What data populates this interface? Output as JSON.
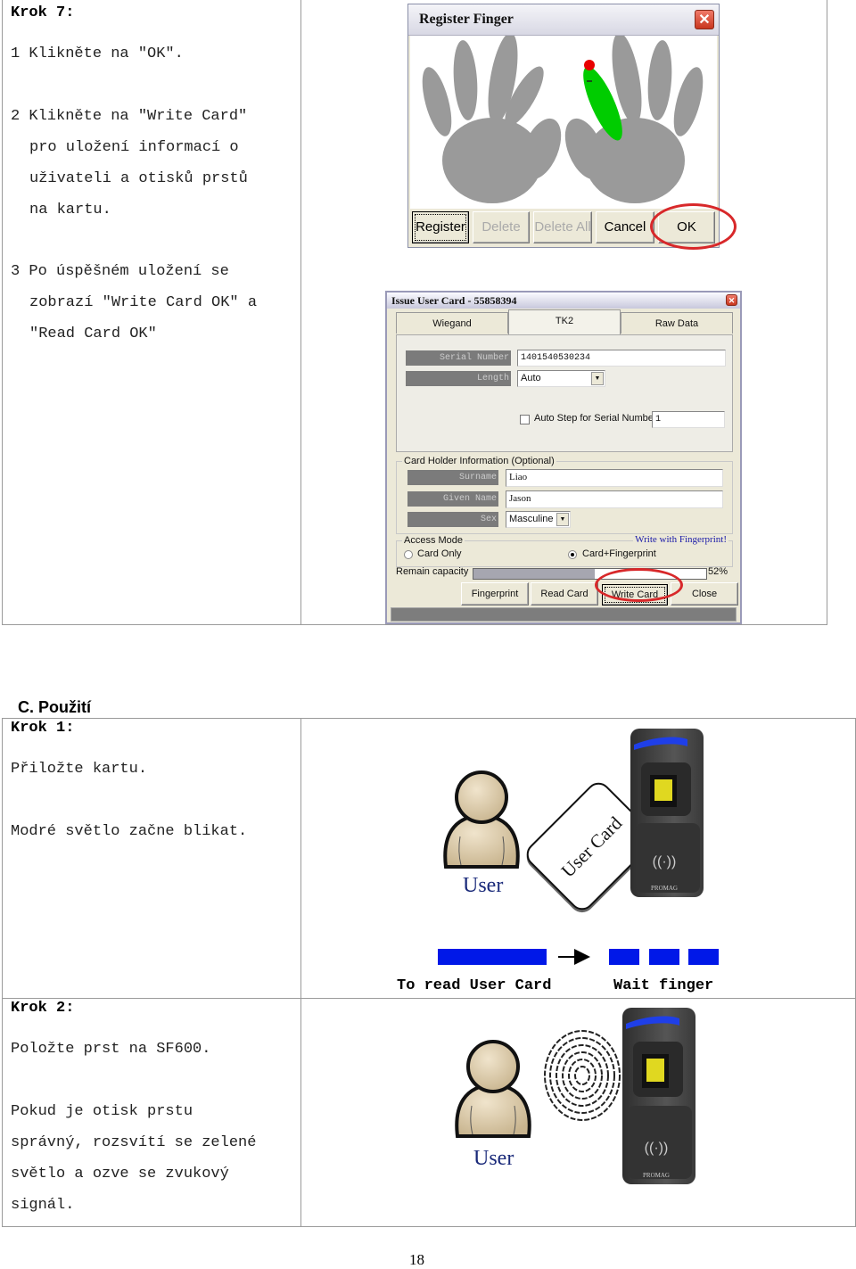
{
  "top_section": {
    "step_heading": "Krok 7:",
    "instructions": [
      {
        "line": "1 Klikněte na \"OK\"."
      },
      {
        "line": "2 Klikněte na \"Write Card\""
      },
      {
        "line": "pro uložení informací o"
      },
      {
        "line": "uživateli a otisků prstů"
      },
      {
        "line": "na kartu."
      },
      {
        "line": "3 Po úspěšném uložení se"
      },
      {
        "line": "zobrazí \"Write Card OK\" a"
      },
      {
        "line": "\"Read Card OK\""
      }
    ],
    "register_finger_dialog": {
      "title": "Register Finger",
      "close_glyph": "✕",
      "selected_finger": "right-index",
      "buttons": [
        {
          "label": "Register",
          "enabled": true,
          "focused": true
        },
        {
          "label": "Delete",
          "enabled": false
        },
        {
          "label": "Delete All",
          "enabled": false
        },
        {
          "label": "Cancel",
          "enabled": true
        },
        {
          "label": "OK",
          "enabled": true,
          "highlighted": true
        }
      ]
    },
    "issue_user_card_dialog": {
      "title": "Issue User Card - 55858394",
      "close_glyph": "✕",
      "tabs": [
        {
          "label": "Wiegand",
          "active": false
        },
        {
          "label": "TK2",
          "active": true
        },
        {
          "label": "Raw Data",
          "active": false
        }
      ],
      "serial_number_label": "Serial Number",
      "serial_number_value": "1401540530234",
      "length_label": "Length",
      "length_value": "Auto",
      "auto_step_label": "Auto Step for Serial Number",
      "auto_step_checked": false,
      "auto_step_value": "1",
      "card_holder_group": "Card Holder Information (Optional)",
      "surname_label": "Surname",
      "surname_value": "Liao",
      "given_name_label": "Given Name",
      "given_name_value": "Jason",
      "sex_label": "Sex",
      "sex_value": "Masculine",
      "access_mode_group": "Access Mode",
      "write_note": "Write with Fingerprint!",
      "access_options": [
        {
          "label": "Card Only",
          "selected": false
        },
        {
          "label": "Card+Fingerprint",
          "selected": true
        }
      ],
      "remain_capacity_label": "Remain capacity",
      "remain_capacity_percent": 52,
      "remain_capacity_text": "52%",
      "buttons": [
        {
          "label": "Fingerprint"
        },
        {
          "label": "Read Card"
        },
        {
          "label": "Write Card",
          "highlighted": true
        },
        {
          "label": "Close"
        }
      ]
    },
    "accent_color": "#d8282a"
  },
  "section_heading": "C. Použití",
  "bottom_section": {
    "step1": {
      "heading": "Krok 1:",
      "lines": [
        "Přiložte kartu.",
        "Modré světlo začne blikat."
      ],
      "user_label": "User",
      "card_label": "User Card",
      "device_brand": "PROMAG",
      "caption_read": "To read User Card",
      "caption_wait": "Wait finger",
      "indicator_color": "#0018e8"
    },
    "step2": {
      "heading": "Krok 2:",
      "lines": [
        "Položte prst na SF600.",
        "Pokud je otisk prstu",
        "správný, rozsvítí se zelené",
        "světlo a ozve se zvukový",
        "signál."
      ],
      "user_label": "User",
      "device_brand": "PROMAG"
    }
  },
  "page_number": "18"
}
